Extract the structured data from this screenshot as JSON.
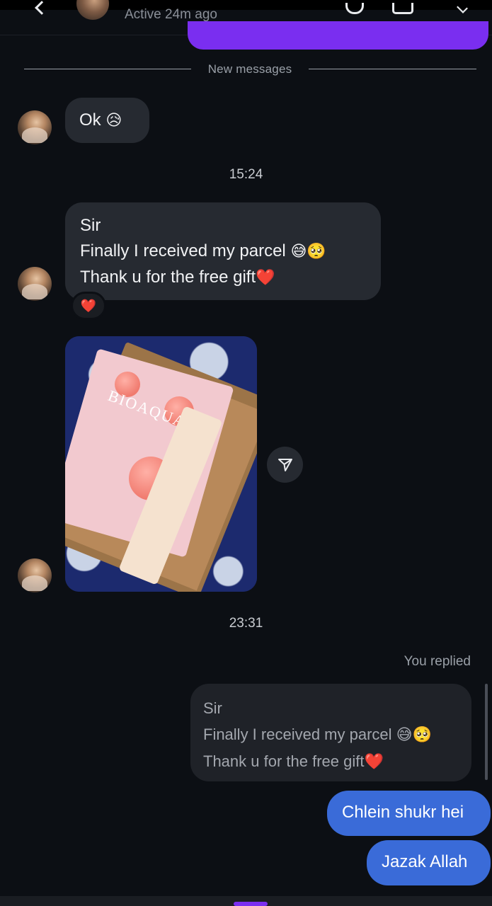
{
  "header": {
    "active_status": "Active 24m ago"
  },
  "separator": {
    "label": "New messages"
  },
  "messages": {
    "m1": {
      "text": "Ok",
      "emoji": "😥"
    },
    "time1": "15:24",
    "m2": {
      "line1": "Sir",
      "line2": "Finally I received my parcel",
      "line2_emoji": "😅🥺",
      "line3": "Thank u for the free gift",
      "line3_emoji": "❤️",
      "reaction": "❤️"
    },
    "photo": {
      "brand_text": "BIOAQUA"
    },
    "time2": "23:31",
    "reply_label": "You replied",
    "quoted": {
      "line1": "Sir",
      "line2": "Finally I received my parcel",
      "line2_emoji": "😅🥺",
      "line3": "Thank u for the free gift",
      "line3_emoji": "❤️"
    },
    "out1": "Chlein shukr hei",
    "out2": "Jazak Allah"
  },
  "colors": {
    "background": "#0c0f14",
    "incoming_bubble": "#262a31",
    "outgoing_bubble": "#3a6bd8",
    "accent_purple": "#7a2ef0",
    "reaction_heart": "#e02c3b"
  },
  "icons": {
    "back": "chevron-left-icon",
    "call": "phone-icon",
    "video": "video-camera-icon",
    "info": "chevron-down-icon",
    "share": "paper-plane-icon"
  }
}
